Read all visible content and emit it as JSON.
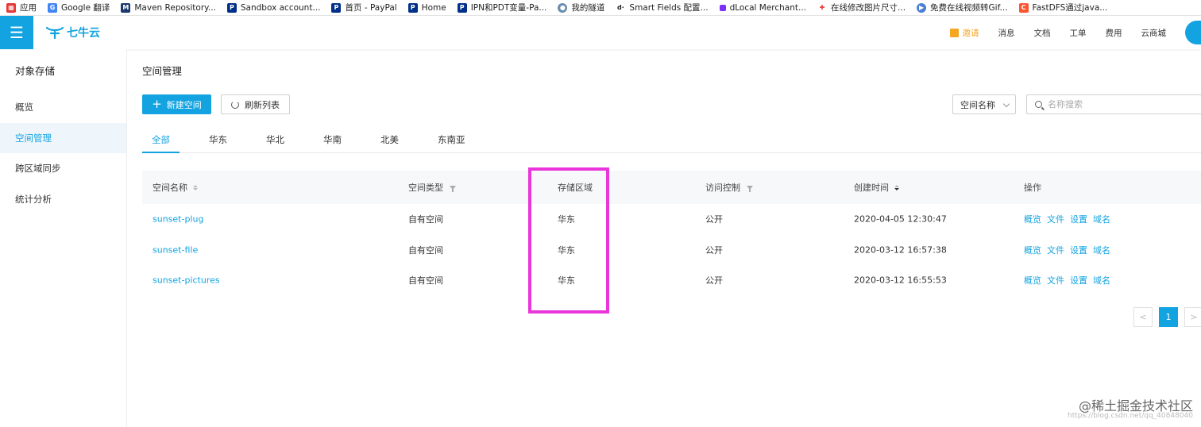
{
  "bookmarks": [
    {
      "label": "应用",
      "icon": "apps-grid-icon",
      "color": "#e53935"
    },
    {
      "label": "Google 翻译",
      "icon": "google-translate-icon",
      "color": "#4285f4"
    },
    {
      "label": "Maven Repository...",
      "icon": "maven-icon",
      "color": "#1a3a6e"
    },
    {
      "label": "Sandbox account...",
      "icon": "paypal-icon",
      "color": "#003087"
    },
    {
      "label": "首页 - PayPal",
      "icon": "paypal-icon",
      "color": "#003087"
    },
    {
      "label": "Home",
      "icon": "paypal-icon",
      "color": "#003087"
    },
    {
      "label": "IPN和PDT变量-Pa...",
      "icon": "paypal-icon",
      "color": "#003087"
    },
    {
      "label": "我的隧道",
      "icon": "globe-icon",
      "color": "#6a8caf"
    },
    {
      "label": "Smart Fields 配置...",
      "icon": "dlocal-icon",
      "color": "#222222"
    },
    {
      "label": "dLocal Merchant...",
      "icon": "purple-square-icon",
      "color": "#7b2ff7"
    },
    {
      "label": "在线修改图片尺寸...",
      "icon": "resize-icon",
      "color": "#e53935"
    },
    {
      "label": "免费在线视频转Gif...",
      "icon": "video-icon",
      "color": "#4a7fd4"
    },
    {
      "label": "FastDFS通过java...",
      "icon": "csdn-icon",
      "color": "#fc5531"
    }
  ],
  "topnav": {
    "logo_text": "七牛云",
    "gift_label": "邀请",
    "items": [
      "消息",
      "文档",
      "工单",
      "费用",
      "云商城"
    ]
  },
  "sidebar": {
    "title": "对象存储",
    "items": [
      {
        "label": "概览",
        "active": false
      },
      {
        "label": "空间管理",
        "active": true
      },
      {
        "label": "跨区域同步",
        "active": false
      },
      {
        "label": "统计分析",
        "active": false
      }
    ]
  },
  "main": {
    "title": "空间管理",
    "new_button": "新建空间",
    "refresh_button": "刷新列表",
    "select_value": "空间名称",
    "search_placeholder": "名称搜索",
    "tabs": [
      "全部",
      "华东",
      "华北",
      "华南",
      "北美",
      "东南亚"
    ]
  },
  "table": {
    "headers": [
      "空间名称",
      "空间类型",
      "存储区域",
      "访问控制",
      "创建时间",
      "操作"
    ],
    "rows": [
      {
        "name": "sunset-plug",
        "type": "自有空间",
        "region": "华东",
        "access": "公开",
        "created": "2020-04-05 12:30:47"
      },
      {
        "name": "sunset-file",
        "type": "自有空间",
        "region": "华东",
        "access": "公开",
        "created": "2020-03-12 16:57:38"
      },
      {
        "name": "sunset-pictures",
        "type": "自有空间",
        "region": "华东",
        "access": "公开",
        "created": "2020-03-12 16:55:53"
      }
    ],
    "actions": [
      "概览",
      "文件",
      "设置",
      "域名"
    ]
  },
  "pager": {
    "prev": "<",
    "current": "1",
    "next": ">"
  },
  "watermark": {
    "text": "@稀土掘金技术社区",
    "sub": "https://blog.csdn.net/qq_40848040"
  },
  "colors": {
    "accent": "#13a3e0",
    "highlight": "#e935d9",
    "gift": "#f5a623"
  }
}
